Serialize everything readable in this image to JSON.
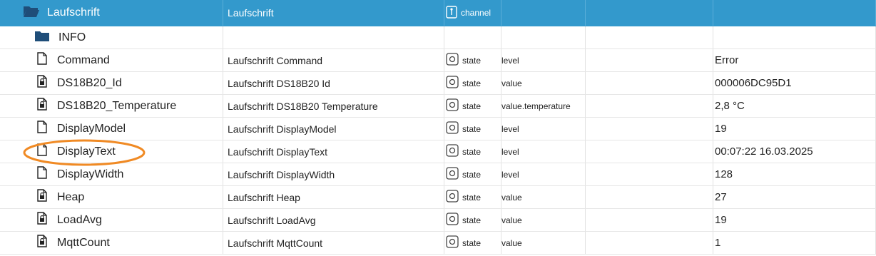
{
  "rows": [
    {
      "id": "Laufschrift",
      "name": "Laufschrift",
      "type": "channel",
      "role": "",
      "value": ""
    },
    {
      "id": "INFO",
      "name": "",
      "type": "",
      "role": "",
      "value": ""
    },
    {
      "id": "Command",
      "name": "Laufschrift Command",
      "type": "state",
      "role": "level",
      "value": "Error"
    },
    {
      "id": "DS18B20_Id",
      "name": "Laufschrift DS18B20 Id",
      "type": "state",
      "role": "value",
      "value": "000006DC95D1"
    },
    {
      "id": "DS18B20_Temperature",
      "name": "Laufschrift DS18B20 Temperature",
      "type": "state",
      "role": "value.temperature",
      "value": "2,8 °C"
    },
    {
      "id": "DisplayModel",
      "name": "Laufschrift DisplayModel",
      "type": "state",
      "role": "level",
      "value": "19"
    },
    {
      "id": "DisplayText",
      "name": "Laufschrift DisplayText",
      "type": "state",
      "role": "level",
      "value": "00:07:22 16.03.2025"
    },
    {
      "id": "DisplayWidth",
      "name": "Laufschrift DisplayWidth",
      "type": "state",
      "role": "level",
      "value": "128"
    },
    {
      "id": "Heap",
      "name": "Laufschrift Heap",
      "type": "state",
      "role": "value",
      "value": "27"
    },
    {
      "id": "LoadAvg",
      "name": "Laufschrift LoadAvg",
      "type": "state",
      "role": "value",
      "value": "19"
    },
    {
      "id": "MqttCount",
      "name": "Laufschrift MqttCount",
      "type": "state",
      "role": "value",
      "value": "1"
    }
  ],
  "colors": {
    "selected_row": "#3399cc",
    "folder_icon": "#1f4e79",
    "highlight_ellipse": "#f08a24"
  },
  "icons": {
    "channel_row": "folder-open-icon",
    "info_row": "folder-icon",
    "plain_state": "file-icon",
    "locked_state": "file-lock-icon",
    "type_channel": "channel-icon",
    "type_state": "state-icon"
  }
}
